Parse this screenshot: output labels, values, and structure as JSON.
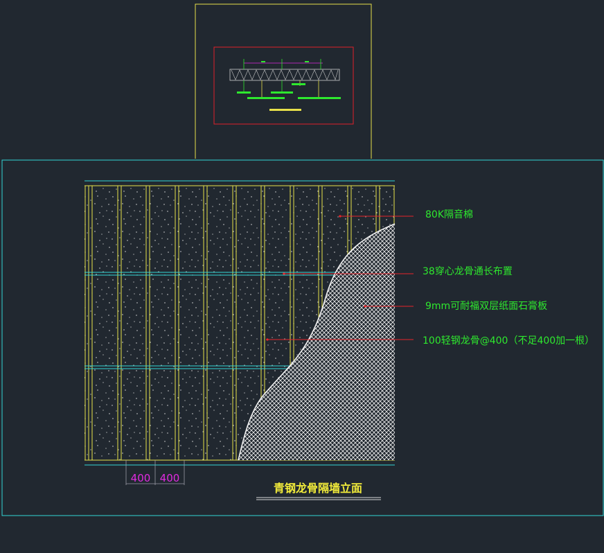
{
  "colors": {
    "background": "#212830",
    "frame_cyan": "#33d6d6",
    "frame_yellow": "#e8e04a",
    "frame_red": "#e0202a",
    "stud_yellow": "#e6e24a",
    "leader_red": "#e8242a",
    "label_green": "#2ee82e",
    "dim_magenta": "#e02ae0",
    "title_yellow": "#f2ec3a",
    "board_white": "#f2f2f2"
  },
  "annotations": [
    {
      "id": "insulation",
      "text": "80K隔音棉"
    },
    {
      "id": "channel",
      "text": "38穿心龙骨通长布置"
    },
    {
      "id": "board",
      "text": "9mm可耐福双层纸面石膏板"
    },
    {
      "id": "stud",
      "text": "100轻钢龙骨@400（不足400加一根）"
    }
  ],
  "dimensions": [
    {
      "value": "400"
    },
    {
      "value": "400"
    }
  ],
  "drawing_title": "青钢龙骨隔墙立面"
}
